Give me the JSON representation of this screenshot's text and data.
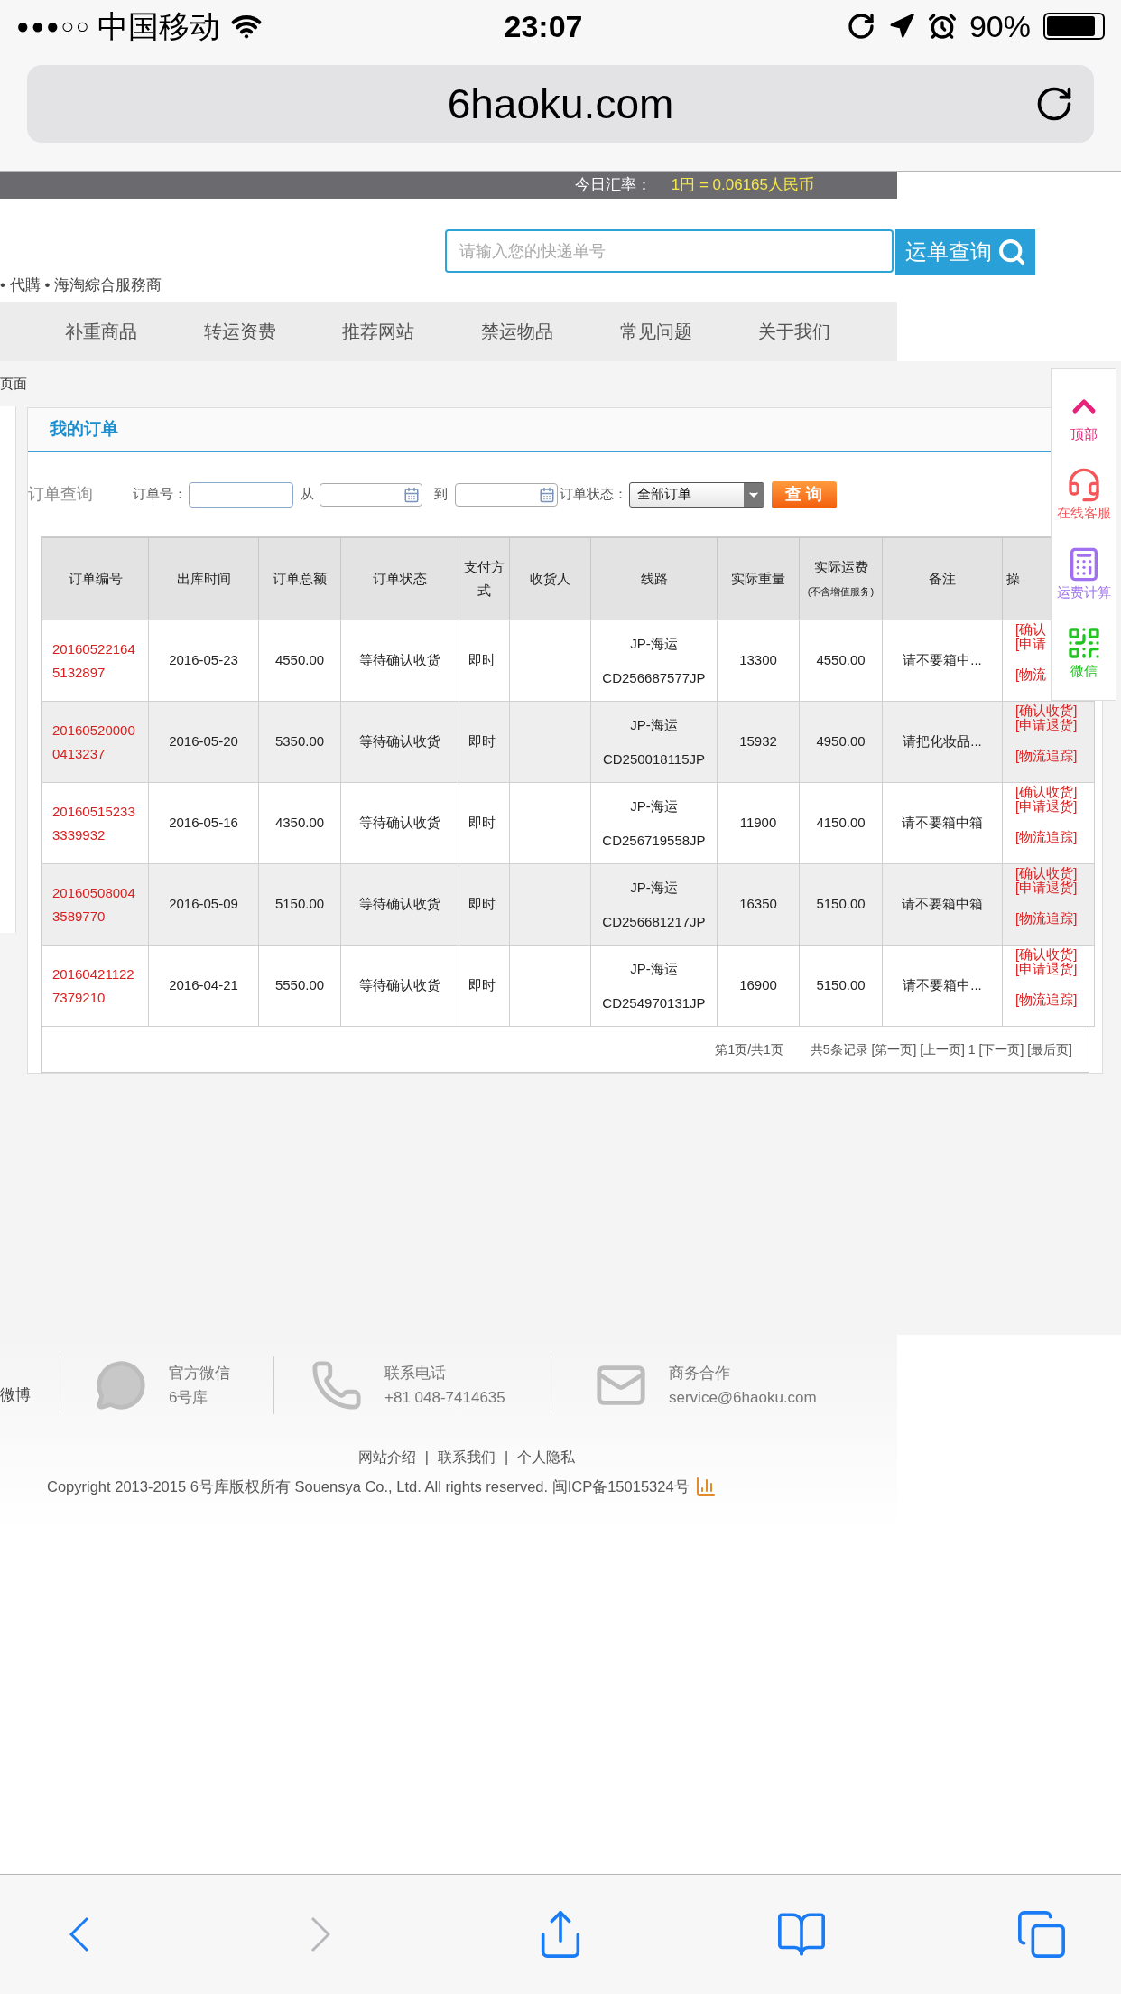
{
  "status_bar": {
    "signal": "●●●○○",
    "carrier": "中国移动",
    "time": "23:07",
    "battery": "90%"
  },
  "url_bar": {
    "url": "6haoku.com"
  },
  "rate_bar": {
    "label": "今日汇率：",
    "value": "1円 = 0.06165人民币"
  },
  "header": {
    "tagline": "• 代購 • 海淘綜合服務商",
    "search": {
      "placeholder": "请输入您的快递单号"
    },
    "search_button": "运单查询"
  },
  "nav": [
    "补重商品",
    "转运资费",
    "推荐网站",
    "禁运物品",
    "常见问题",
    "关于我们"
  ],
  "breadcrumb": "页面",
  "orders": {
    "title": "我的订单",
    "filter": {
      "label": "订单查询",
      "order_no_label": "订单号：",
      "from_label": "从",
      "to_label": "到",
      "status_label": "订单状态：",
      "status_value": "全部订单",
      "query_button": "查 询"
    },
    "columns": [
      {
        "label": "订单编号"
      },
      {
        "label": "出库时间"
      },
      {
        "label": "订单总额"
      },
      {
        "label": "订单状态"
      },
      {
        "label": "支付方式"
      },
      {
        "label": "收货人"
      },
      {
        "label": "线路"
      },
      {
        "label": "实际重量"
      },
      {
        "label": "实际运费",
        "note": "(不含增值服务)"
      },
      {
        "label": "备注"
      },
      {
        "label": "操"
      }
    ],
    "rows": [
      {
        "order_no": "201605221645132897",
        "date": "2016-05-23",
        "total": "4550.00",
        "status": "等待确认收货",
        "payment": "即时",
        "route": "JP-海运",
        "tracking": "CD256687577JP",
        "weight": "13300",
        "freight": "4550.00",
        "note": "请不要箱中...",
        "actions": [
          "[确认",
          "[申请",
          "[物流"
        ]
      },
      {
        "order_no": "201605200000413237",
        "date": "2016-05-20",
        "total": "5350.00",
        "status": "等待确认收货",
        "payment": "即时",
        "route": "JP-海运",
        "tracking": "CD250018115JP",
        "weight": "15932",
        "freight": "4950.00",
        "note": "请把化妆品...",
        "actions": [
          "[确认收货]",
          "[申请退货]",
          "[物流追踪]"
        ]
      },
      {
        "order_no": "201605152333339932",
        "date": "2016-05-16",
        "total": "4350.00",
        "status": "等待确认收货",
        "payment": "即时",
        "route": "JP-海运",
        "tracking": "CD256719558JP",
        "weight": "11900",
        "freight": "4150.00",
        "note": "请不要箱中箱",
        "actions": [
          "[确认收货]",
          "[申请退货]",
          "[物流追踪]"
        ]
      },
      {
        "order_no": "201605080043589770",
        "date": "2016-05-09",
        "total": "5150.00",
        "status": "等待确认收货",
        "payment": "即时",
        "route": "JP-海运",
        "tracking": "CD256681217JP",
        "weight": "16350",
        "freight": "5150.00",
        "note": "请不要箱中箱",
        "actions": [
          "[确认收货]",
          "[申请退货]",
          "[物流追踪]"
        ]
      },
      {
        "order_no": "201604211227379210",
        "date": "2016-04-21",
        "total": "5550.00",
        "status": "等待确认收货",
        "payment": "即时",
        "route": "JP-海运",
        "tracking": "CD254970131JP",
        "weight": "16900",
        "freight": "5150.00",
        "note": "请不要箱中...",
        "actions": [
          "[确认收货]",
          "[申请退货]",
          "[物流追踪]"
        ]
      }
    ],
    "pagination": {
      "pages": "第1页/共1页",
      "records": "共5条记录 [第一页] [上一页] 1 [下一页] [最后页]"
    }
  },
  "side_panel": [
    {
      "kind": "top",
      "label": "顶部",
      "color": "#e8227a"
    },
    {
      "kind": "service",
      "label": "在线客服",
      "color": "#f5565a"
    },
    {
      "kind": "calculator",
      "label": "运费计算",
      "color": "#a070f0"
    },
    {
      "kind": "wechat",
      "label": "微信",
      "color": "#22c322"
    }
  ],
  "footer": {
    "weibo": "微博",
    "contacts": [
      {
        "kind": "wechat",
        "title": "官方微信",
        "value": "6号库"
      },
      {
        "kind": "phone",
        "title": "联系电话",
        "value": "+81 048-7414635"
      },
      {
        "kind": "mail",
        "title": "商务合作",
        "value": "service@6haoku.com"
      }
    ],
    "links": [
      "网站介绍",
      "联系我们",
      "个人隐私"
    ],
    "link_separator": "|",
    "copyright": "Copyright 2013-2015 6号库版权所有 Souensya Co., Ltd. All rights reserved. 闽ICP备15015324号"
  },
  "toolbar": [
    {
      "kind": "back",
      "disabled": false
    },
    {
      "kind": "forward",
      "disabled": true
    },
    {
      "kind": "share",
      "disabled": false
    },
    {
      "kind": "bookmarks",
      "disabled": false
    },
    {
      "kind": "tabs",
      "disabled": false
    }
  ]
}
